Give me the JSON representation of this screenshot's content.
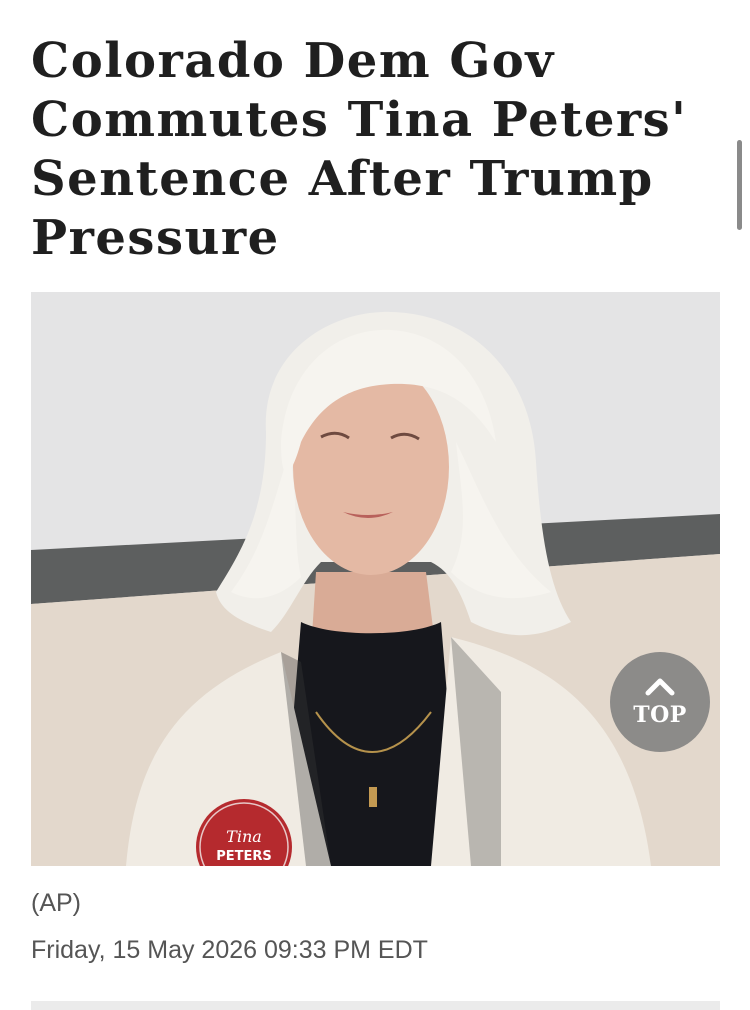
{
  "article": {
    "headline": "Colorado Dem Gov Commutes Tina Peters' Sentence After Trump Pressure",
    "photo_credit": "(AP)",
    "dateline": "Friday, 15 May 2026 09:33 PM EDT",
    "photo": {
      "description_icon": "news-photo",
      "badge_text_line1": "Tina",
      "badge_text_line2": "PETERS"
    }
  },
  "top_button": {
    "label": "TOP",
    "icon": "chevron-up-icon"
  },
  "colors": {
    "headline": "#1f1f1f",
    "meta_text": "#555555",
    "top_button_bg": "#808080",
    "divider": "#ebebeb"
  }
}
